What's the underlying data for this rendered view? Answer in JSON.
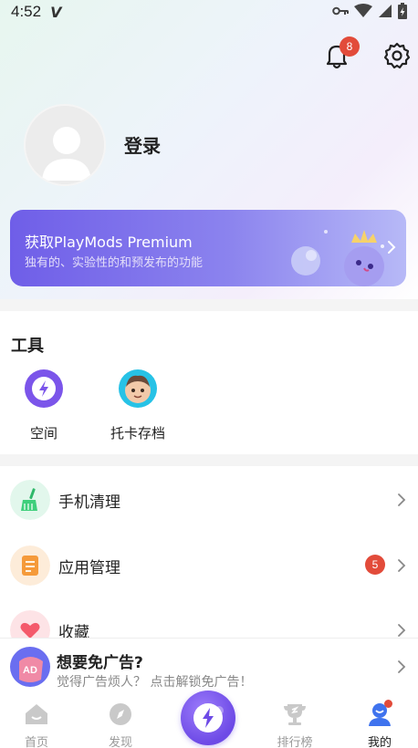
{
  "status_bar": {
    "time": "4:52",
    "app_glyph": "V"
  },
  "header": {
    "notification_count": "8"
  },
  "profile": {
    "login_label": "登录"
  },
  "premium": {
    "title": "获取PlayMods Premium",
    "subtitle": "独有的、实验性的和预发布的功能"
  },
  "tools": {
    "title": "工具",
    "items": [
      {
        "label": "空间",
        "icon": "space-icon"
      },
      {
        "label": "托卡存档",
        "icon": "toca-save-icon"
      }
    ]
  },
  "menu": {
    "items": [
      {
        "label": "手机清理",
        "icon": "broom-icon"
      },
      {
        "label": "应用管理",
        "icon": "app-manage-icon",
        "badge": "5"
      },
      {
        "label": "收藏",
        "icon": "heart-icon"
      }
    ]
  },
  "ad_banner": {
    "title": "想要免广告?",
    "subtitle": "觉得广告烦人？ 点击解锁免广告！",
    "icon_text": "AD"
  },
  "bottom_nav": {
    "items": [
      {
        "label": "首页",
        "icon": "home-icon"
      },
      {
        "label": "发现",
        "icon": "compass-icon"
      },
      {
        "label": "排行榜",
        "icon": "trophy-icon"
      },
      {
        "label": "我的",
        "icon": "profile-icon",
        "active": true
      }
    ]
  },
  "colors": {
    "accent": "#6d4ae6",
    "badge": "#e24b3a",
    "premium_start": "#6f5ee8",
    "premium_end": "#b7b9f7"
  }
}
